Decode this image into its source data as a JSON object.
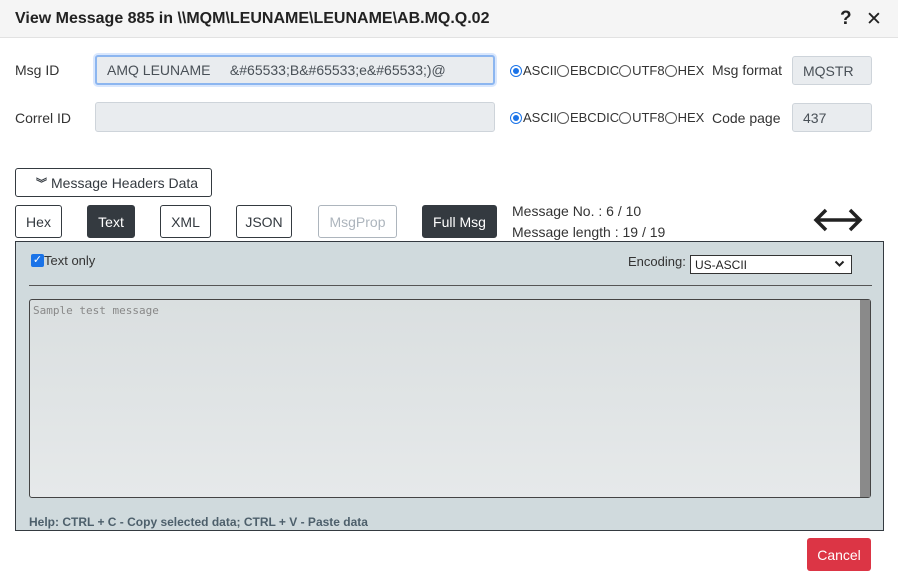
{
  "window": {
    "title": "View Message 885 in \\\\MQM\\LEUNAME\\LEUNAME\\AB.MQ.Q.02"
  },
  "icons": {
    "help": "?",
    "close": "✕"
  },
  "msgid": {
    "label": "Msg ID",
    "value": "AMQ LEUNAME     &#65533;B&#65533;e&#65533;)@"
  },
  "correlid": {
    "label": "Correl ID",
    "value": ""
  },
  "encoding_radios": {
    "options": [
      "ASCII",
      "EBCDIC",
      "UTF8",
      "HEX"
    ],
    "msgid_selected": "ASCII",
    "correlid_selected": "ASCII"
  },
  "msg_format": {
    "label": "Msg format",
    "value": "MQSTR"
  },
  "code_page": {
    "label": "Code page",
    "value": "437"
  },
  "headers_button": {
    "label": "Message Headers Data"
  },
  "view_tabs": [
    {
      "label": "Hex",
      "state": "normal"
    },
    {
      "label": "Text",
      "state": "active"
    },
    {
      "label": "XML",
      "state": "normal"
    },
    {
      "label": "JSON",
      "state": "normal"
    },
    {
      "label": "MsgProp",
      "state": "disabled"
    },
    {
      "label": "Full Msg",
      "state": "active"
    }
  ],
  "message_info": {
    "number": "Message No. : 6 / 10",
    "length": "Message length : 19 / 19"
  },
  "panel": {
    "text_only_label": "Text only",
    "text_only_checked": true,
    "encoding_label": "Encoding:",
    "encoding_value": "US-ASCII",
    "message_placeholder": "Sample test message",
    "help": "Help: CTRL + C - Copy selected data; CTRL + V - Paste data"
  },
  "cancel_button": {
    "label": "Cancel"
  },
  "colors": {
    "accent": "#1a73e8",
    "danger": "#dc3545",
    "dark": "#343a40",
    "panel": "#d0dadd"
  }
}
